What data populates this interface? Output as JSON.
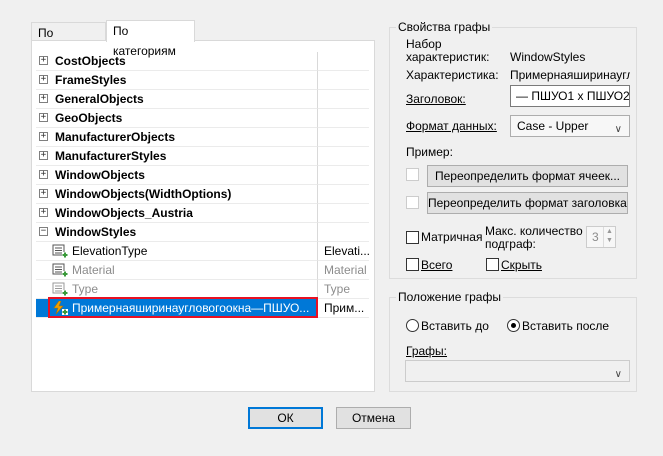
{
  "tabs": {
    "alphabet": "По алфавиту",
    "categories": "По категориям"
  },
  "grid": {
    "categories": [
      {
        "label": "CostObjects",
        "expander": "+"
      },
      {
        "label": "FrameStyles",
        "expander": "+"
      },
      {
        "label": "GeneralObjects",
        "expander": "+"
      },
      {
        "label": "GeoObjects",
        "expander": "+"
      },
      {
        "label": "ManufacturerObjects",
        "expander": "+"
      },
      {
        "label": "ManufacturerStyles",
        "expander": "+"
      },
      {
        "label": "WindowObjects",
        "expander": "+"
      },
      {
        "label": "WindowObjects(WidthOptions)",
        "expander": "+"
      },
      {
        "label": "WindowObjects_Austria",
        "expander": "+"
      },
      {
        "label": "WindowStyles",
        "expander": "−"
      }
    ],
    "properties": [
      {
        "name": "ElevationType",
        "value": "Elevati..."
      },
      {
        "name": "Material",
        "value": "Material"
      },
      {
        "name": "Type",
        "value": "Type"
      }
    ],
    "selected": {
      "name": "Примернаяширинаугловогоокна—ПШУО...",
      "value": "Прим..."
    }
  },
  "props": {
    "title": "Свойства графы",
    "set_label_1": "Набор",
    "set_label_2": "характеристик:",
    "set_value": "WindowStyles",
    "char_label": "Характеристика:",
    "char_value": "Примернаяширинаугло",
    "header_label": "Заголовок:",
    "header_value": "— ПШУО1 х ПШУО2",
    "format_label": "Формат данных:",
    "format_value": "Case - Upper",
    "example_label": "Пример:",
    "override_cells": "Переопределить формат ячеек...",
    "override_header": "Переопределить формат заголовка...",
    "matrix_label": "Матричная",
    "max_count_label_1": "Макс. количество",
    "max_count_label_2": "подграф:",
    "max_count_value": "3",
    "total_label": "Всего",
    "hide_label": "Скрыть"
  },
  "position": {
    "title": "Положение графы",
    "insert_before": "Вставить до",
    "insert_after": "Вставить после",
    "columns_label": "Графы:",
    "columns_value": ""
  },
  "footer": {
    "ok": "ОК",
    "cancel": "Отмена"
  },
  "colors": {
    "selection": "#0078d7",
    "highlight_border": "#e81123",
    "icon_green": "#3a9a3a",
    "icon_orange": "#f0a000"
  }
}
